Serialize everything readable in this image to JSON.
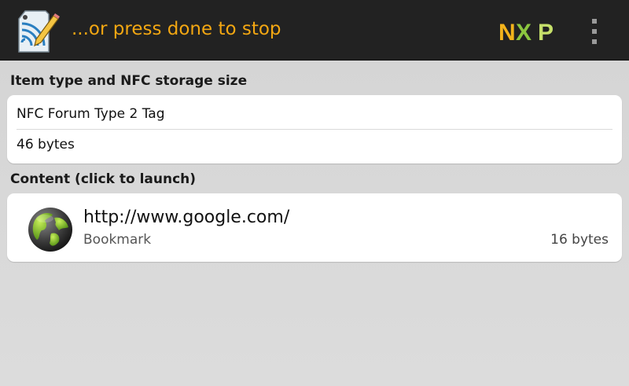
{
  "appbar": {
    "title": "...or press done to stop",
    "app_icon": "nfc-tag-write-icon",
    "brand_logo_text": "NXP",
    "overflow_icon": "overflow-menu-icon",
    "accent_color": "#f3a712"
  },
  "item_section": {
    "label": "Item type and NFC storage size",
    "tag_type": "NFC Forum Type 2 Tag",
    "storage_size": "46 bytes"
  },
  "content_section": {
    "label": "Content (click to launch)",
    "records": [
      {
        "icon": "globe-icon",
        "url": "http://www.google.com/",
        "type": "Bookmark",
        "size": "16 bytes"
      }
    ]
  }
}
